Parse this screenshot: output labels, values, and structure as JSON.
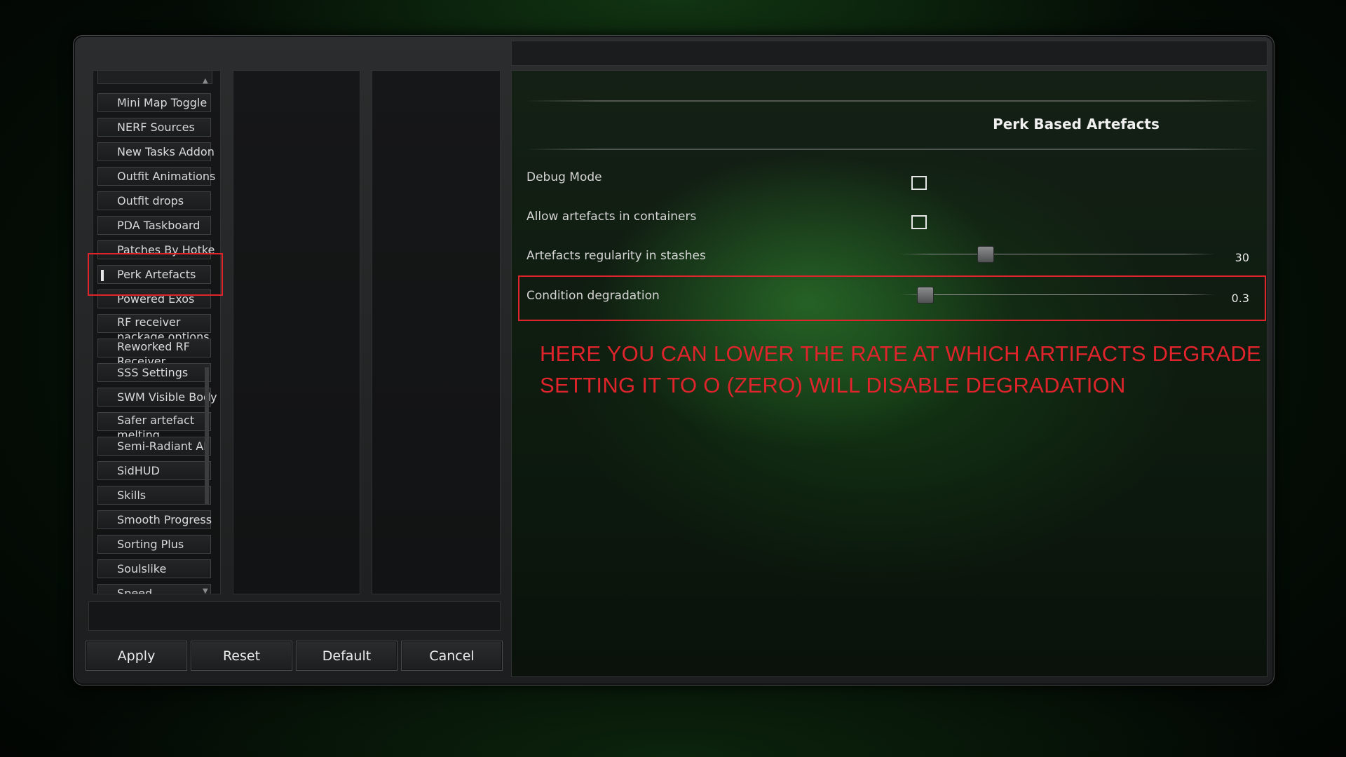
{
  "mod_list": {
    "items": [
      {
        "label": "Mini Map Toggle"
      },
      {
        "label": "NERF Sources"
      },
      {
        "label": "New Tasks Addon"
      },
      {
        "label": "Outfit Animations"
      },
      {
        "label": "Outfit drops"
      },
      {
        "label": "PDA Taskboard"
      },
      {
        "label": "Patches By Hotke"
      },
      {
        "label": "Perk Artefacts",
        "selected": true
      },
      {
        "label": "Powered Exos"
      },
      {
        "label": "RF receiver package options"
      },
      {
        "label": "Reworked RF Receiver"
      },
      {
        "label": "SSS Settings"
      },
      {
        "label": "SWM Visible Body"
      },
      {
        "label": "Safer artefact melting"
      },
      {
        "label": "Semi-Radiant AI"
      },
      {
        "label": "SidHUD"
      },
      {
        "label": "Skills"
      },
      {
        "label": "Smooth Progress"
      },
      {
        "label": "Sorting Plus"
      },
      {
        "label": "Soulslike"
      },
      {
        "label": "Speed"
      }
    ]
  },
  "buttons": {
    "apply": "Apply",
    "reset": "Reset",
    "default": "Default",
    "cancel": "Cancel"
  },
  "panel": {
    "title": "Perk Based Artefacts",
    "options": {
      "debug_mode": {
        "label": "Debug Mode",
        "type": "checkbox",
        "checked": false
      },
      "allow_containers": {
        "label": "Allow artefacts in containers",
        "type": "checkbox",
        "checked": false
      },
      "regularity": {
        "label": "Artefacts regularity in stashes",
        "type": "slider",
        "value": "30",
        "fraction": 0.27
      },
      "degradation": {
        "label": "Condition degradation",
        "type": "slider",
        "value": "0.3",
        "fraction": 0.08
      }
    }
  },
  "annotation": {
    "line1": "HERE YOU CAN LOWER THE RATE AT WHICH ARTIFACTS DEGRADE",
    "line2": "SETTING IT TO O (ZERO) WILL DISABLE DEGRADATION",
    "color": "#e0242c"
  }
}
